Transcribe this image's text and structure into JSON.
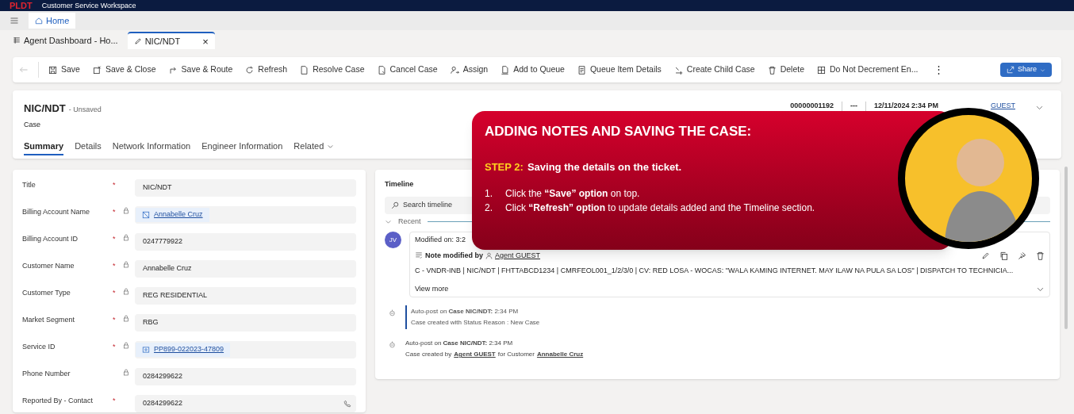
{
  "app_bar": {
    "logo": "PLDT",
    "title": "Customer Service Workspace"
  },
  "nav": {
    "home_tab": "Home"
  },
  "session_tabs": [
    {
      "label": "Agent Dashboard - Ho...",
      "selected": false
    },
    {
      "label": "NIC/NDT",
      "selected": true,
      "close": "×"
    }
  ],
  "commands": [
    {
      "label": "Save"
    },
    {
      "label": "Save & Close"
    },
    {
      "label": "Save & Route"
    },
    {
      "label": "Refresh"
    },
    {
      "label": "Resolve Case"
    },
    {
      "label": "Cancel Case"
    },
    {
      "label": "Assign"
    },
    {
      "label": "Add to Queue"
    },
    {
      "label": "Queue Item Details"
    },
    {
      "label": "Create Child Case"
    },
    {
      "label": "Delete"
    },
    {
      "label": "Do Not Decrement En..."
    }
  ],
  "more_button": "⋮",
  "share_button": "Share",
  "record": {
    "title": "NIC/NDT",
    "status": "- Unsaved",
    "entity": "Case",
    "header_fields": [
      {
        "value": "00000001192",
        "kind": "text"
      },
      {
        "value": "---",
        "kind": "text"
      },
      {
        "value": "12/11/2024 2:34 PM",
        "kind": "text"
      },
      {
        "value": "GUEST",
        "kind": "link"
      }
    ]
  },
  "form_tabs": [
    {
      "label": "Summary",
      "selected": true,
      "kind": "tab"
    },
    {
      "label": "Details",
      "selected": false,
      "kind": "tab"
    },
    {
      "label": "Network Information",
      "selected": false,
      "kind": "tab"
    },
    {
      "label": "Engineer Information",
      "selected": false,
      "kind": "tab"
    },
    {
      "label": "Related",
      "selected": false,
      "kind": "dropdown"
    }
  ],
  "fields": [
    {
      "label": "Title",
      "required_mark": "*",
      "locked": false,
      "value": "NIC/NDT",
      "kind": "text"
    },
    {
      "label": "Billing Account Name",
      "required_mark": "*",
      "locked": true,
      "value": "Annabelle Cruz",
      "kind": "account-link"
    },
    {
      "label": "Billing Account ID",
      "required_mark": "*",
      "locked": true,
      "value": "0247779922",
      "kind": "text"
    },
    {
      "label": "Customer Name",
      "required_mark": "*",
      "locked": true,
      "value": "Annabelle Cruz",
      "kind": "text"
    },
    {
      "label": "Customer Type",
      "required_mark": "*",
      "locked": true,
      "value": "REG RESIDENTIAL",
      "kind": "text"
    },
    {
      "label": "Market Segment",
      "required_mark": "*",
      "locked": true,
      "value": "RBG",
      "kind": "text"
    },
    {
      "label": "Service ID",
      "required_mark": "*",
      "locked": true,
      "value": "PP899-022023-47809",
      "kind": "service-link"
    },
    {
      "label": "Phone Number",
      "locked": true,
      "value": "0284299622",
      "kind": "text"
    },
    {
      "label": "Reported By - Contact",
      "required_mark": "*",
      "locked": false,
      "value": "0284299622",
      "kind": "phone"
    }
  ],
  "timeline": {
    "title": "Timeline",
    "search_placeholder": "Search timeline",
    "group": "Recent",
    "note": {
      "avatar": "JV",
      "modified": "Modified on: 3:2",
      "heading": "Note modified by",
      "author": "Agent GUEST",
      "body": "C - VNDR-INB | NIC/NDT | FHTTABCD1234 | CMRFEOL001_1/2/3/0 | CV: RED LOSA - WOCAS: \"WALA KAMING INTERNET. MAY ILAW NA PULA SA LOS\" | DISPATCH TO TECHNICIA...",
      "view_more": "View more"
    },
    "posts": [
      {
        "line1": "Auto-post on **Case NIC/NDT:**  2:34 PM",
        "line2": [
          {
            "text": "Case created with Status Reason : New Case",
            "kind": "text"
          }
        ],
        "highlighted": true
      },
      {
        "line1": "Auto-post on **Case NIC/NDT:**  2:34 PM",
        "line2": [
          {
            "text": "Case created by",
            "kind": "text"
          },
          {
            "text": "Agent GUEST",
            "kind": "link"
          },
          {
            "text": "for Customer",
            "kind": "text"
          },
          {
            "text": "Annabelle Cruz",
            "kind": "link"
          }
        ],
        "highlighted": false
      }
    ]
  },
  "tutorial": {
    "title": "ADDING NOTES AND SAVING THE CASE:",
    "step_label": "STEP 2:",
    "step_text": "Saving the details on the ticket.",
    "steps": [
      {
        "number": "1.",
        "text": "Click the **“Save” option** on top."
      },
      {
        "number": "2.",
        "text": "Click **“Refresh” option** to update details added and the Timeline section."
      }
    ]
  }
}
